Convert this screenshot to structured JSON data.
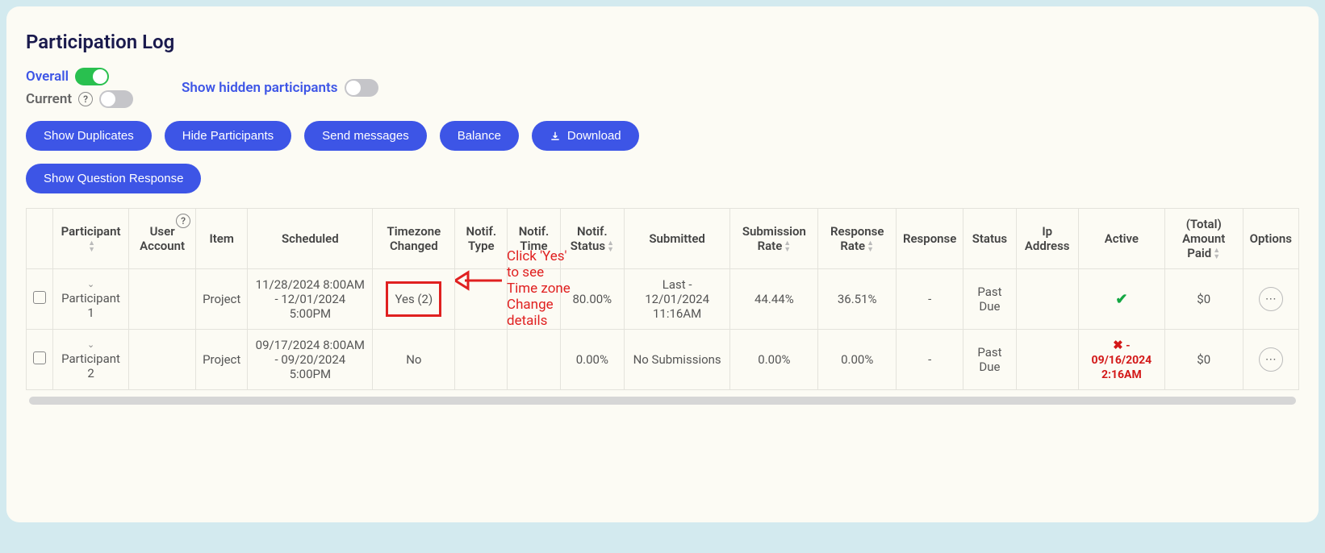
{
  "title": "Participation Log",
  "toggles": {
    "overall": "Overall",
    "current": "Current",
    "showHidden": "Show hidden participants"
  },
  "buttons": {
    "showDup": "Show Duplicates",
    "hideP": "Hide Participants",
    "sendMsg": "Send messages",
    "balance": "Balance",
    "download": "Download",
    "showQR": "Show Question Response"
  },
  "headers": {
    "participant": "Participant",
    "userAccount": "User Account",
    "item": "Item",
    "scheduled": "Scheduled",
    "tzChanged": "Timezone Changed",
    "notifType": "Notif. Type",
    "notifTime": "Notif. Time",
    "notifStatus": "Notif. Status",
    "submitted": "Submitted",
    "subRate": "Submission Rate",
    "respRate": "Response Rate",
    "response": "Response",
    "status": "Status",
    "ip": "Ip Address",
    "active": "Active",
    "totalPaid": "(Total) Amount Paid",
    "options": "Options"
  },
  "rows": [
    {
      "participant": "Participant 1",
      "item": "Project",
      "scheduled": "11/28/2024 8:00AM - 12/01/2024 5:00PM",
      "tz": "Yes (2)",
      "tzBoxed": true,
      "notifStatus": "80.00%",
      "submitted": "Last - 12/01/2024 11:16AM",
      "subRate": "44.44%",
      "respRate": "36.51%",
      "response": "-",
      "status": "Past Due",
      "activeCheck": true,
      "activeText": "",
      "paid": "$0"
    },
    {
      "participant": "Participant 2",
      "item": "Project",
      "scheduled": "09/17/2024 8:00AM - 09/20/2024 5:00PM",
      "tz": "No",
      "tzBoxed": false,
      "notifStatus": "0.00%",
      "submitted": "No Submissions",
      "subRate": "0.00%",
      "respRate": "0.00%",
      "response": "-",
      "status": "Past Due",
      "activeCheck": false,
      "activeText": "09/16/2024 2:16AM",
      "paid": "$0"
    }
  ],
  "annotation": {
    "l1": "Click 'Yes'",
    "l2": "to see",
    "l3": "Time zone",
    "l4": "Change",
    "l5": "details"
  },
  "help": "?",
  "dots": "⋯",
  "xdash": " - "
}
